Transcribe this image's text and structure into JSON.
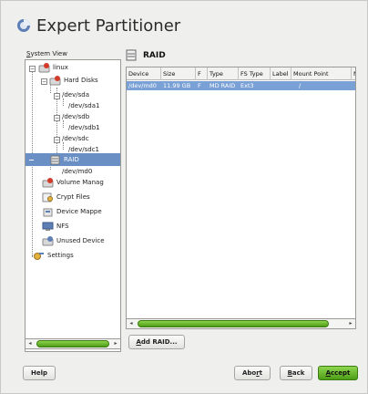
{
  "app": {
    "title": "Expert Partitioner"
  },
  "system_view": {
    "label_prefix": "S",
    "label_rest": "ystem View",
    "tree": [
      {
        "id": "linux",
        "label": "linux",
        "icon": "hard-drive-icon"
      },
      {
        "id": "hard-disks",
        "label": "Hard Disks",
        "icon": "hard-drive-icon"
      },
      {
        "id": "dev-sda",
        "label": "/dev/sda"
      },
      {
        "id": "dev-sda1",
        "label": "/dev/sda1"
      },
      {
        "id": "dev-sdb",
        "label": "/dev/sdb"
      },
      {
        "id": "dev-sdb1",
        "label": "/dev/sdb1"
      },
      {
        "id": "dev-sdc",
        "label": "/dev/sdc"
      },
      {
        "id": "dev-sdc1",
        "label": "/dev/sdc1"
      },
      {
        "id": "raid",
        "label": "RAID",
        "icon": "raid-icon",
        "selected": true
      },
      {
        "id": "dev-md0",
        "label": "/dev/md0"
      },
      {
        "id": "volume-management",
        "label": "Volume Manag",
        "icon": "volume-icon"
      },
      {
        "id": "crypt-files",
        "label": "Crypt Files",
        "icon": "crypt-icon"
      },
      {
        "id": "device-mapper",
        "label": "Device Mappe",
        "icon": "device-mapper-icon"
      },
      {
        "id": "nfs",
        "label": "NFS",
        "icon": "nfs-icon"
      },
      {
        "id": "unused-devices",
        "label": "Unused Device",
        "icon": "unused-device-icon"
      },
      {
        "id": "settings",
        "label": "Settings",
        "icon": "settings-icon"
      }
    ],
    "scroll_thumb_fraction": 0.85
  },
  "raid_view": {
    "header": "RAID",
    "columns": [
      "Device",
      "Size",
      "F",
      "Type",
      "FS Type",
      "Label",
      "Mount Point",
      "M"
    ],
    "rows": [
      {
        "device": "/dev/md0",
        "size": "11.99 GB",
        "f": "F",
        "type": "MD RAID",
        "fs_type": "Ext3",
        "label": "",
        "mount_point": "/",
        "m": ""
      }
    ],
    "scroll_thumb_fraction": 0.9
  },
  "buttons": {
    "add_raid_a": "A",
    "add_raid_rest": "dd RAID...",
    "help": "Help",
    "abort_pre": "Abo",
    "abort_u": "r",
    "abort_post": "t",
    "back_u": "B",
    "back_rest": "ack",
    "accept_u": "A",
    "accept_rest": "ccept"
  },
  "colors": {
    "selection": "#6a8fc4",
    "row_selection": "#7aa1d6",
    "accent_green": "#4e9d17"
  }
}
